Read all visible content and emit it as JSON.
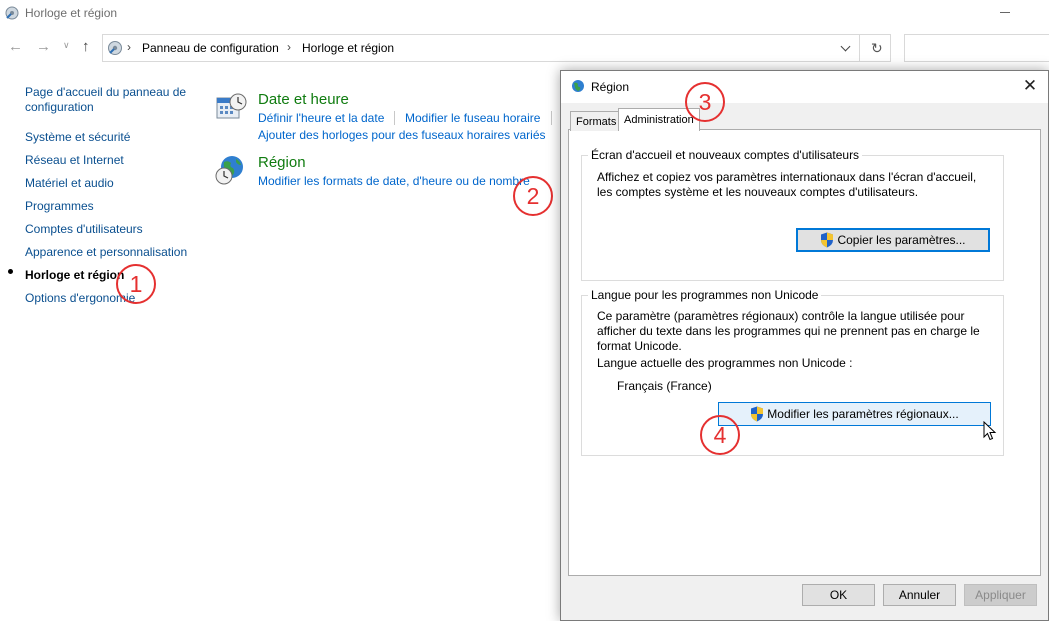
{
  "window": {
    "title": "Horloge et région"
  },
  "address_bar": {
    "breadcrumbs": [
      "Panneau de configuration",
      "Horloge et région"
    ]
  },
  "sidebar": {
    "home_label": "Page d'accueil du panneau de configuration",
    "items": [
      {
        "label": "Système et sécurité",
        "active": false
      },
      {
        "label": "Réseau et Internet",
        "active": false
      },
      {
        "label": "Matériel et audio",
        "active": false
      },
      {
        "label": "Programmes",
        "active": false
      },
      {
        "label": "Comptes d'utilisateurs",
        "active": false
      },
      {
        "label": "Apparence et personnalisation",
        "active": false
      },
      {
        "label": "Horloge et région",
        "active": true
      },
      {
        "label": "Options d'ergonomie",
        "active": false
      }
    ]
  },
  "categories": {
    "date": {
      "title": "Date et heure",
      "links": [
        "Définir l'heure et la date",
        "Modifier le fuseau horaire",
        "Ajouter des horloges pour des fuseaux horaires variés"
      ]
    },
    "region": {
      "title": "Région",
      "links": [
        "Modifier les formats de date, d'heure ou de nombre"
      ]
    }
  },
  "annotations": [
    "1",
    "2",
    "3",
    "4"
  ],
  "dialog": {
    "title": "Région",
    "tabs": [
      "Formats",
      "Administration"
    ],
    "active_tab": "Administration",
    "welcome_group": {
      "legend": "Écran d'accueil et nouveaux comptes d'utilisateurs",
      "text_line1": "Affichez et copiez vos paramètres internationaux dans l'écran d'accueil,",
      "text_line2": "les comptes système et les nouveaux comptes d'utilisateurs.",
      "button": "Copier les paramètres..."
    },
    "unicode_group": {
      "legend": "Langue pour les programmes non Unicode",
      "text_line1": "Ce paramètre (paramètres régionaux) contrôle la langue utilisée pour",
      "text_line2": "afficher du texte dans les programmes qui ne prennent pas en charge le",
      "text_line3": "format Unicode.",
      "current_label": "Langue actuelle des programmes non Unicode :",
      "current_value": "Français (France)",
      "button": "Modifier les paramètres régionaux..."
    },
    "buttons": {
      "ok": "OK",
      "cancel": "Annuler",
      "apply": "Appliquer"
    }
  },
  "colors": {
    "link": "#0066cc",
    "category_title": "#107c10",
    "annotation": "#e53030",
    "focus": "#0078d7"
  }
}
